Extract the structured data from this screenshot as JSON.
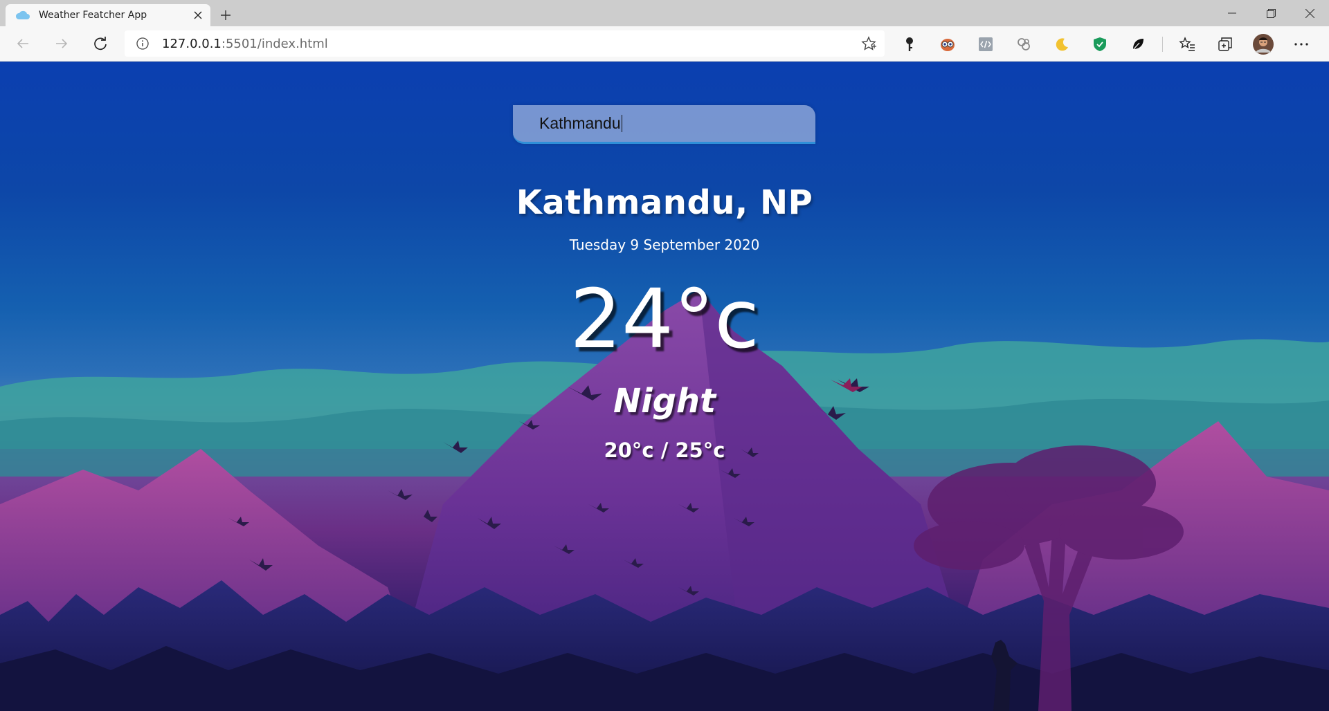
{
  "browser": {
    "tab_title": "Weather Featcher App",
    "url_host": "127.0.0.1",
    "url_path": ":5501/index.html",
    "icons": {
      "tab_favicon": "cloud-icon",
      "tab_close": "close-icon",
      "new_tab": "plus-icon",
      "back": "back-arrow-icon",
      "forward": "forward-arrow-icon",
      "reload": "reload-icon",
      "site_info": "info-icon",
      "favorite": "star-icon",
      "extensions": [
        "key-icon",
        "owl-icon",
        "code-icon",
        "link-icon",
        "moon-icon",
        "shield-icon",
        "leaf-icon"
      ],
      "favorites_list": "favorites-icon",
      "collections": "collections-icon",
      "profile": "avatar",
      "menu": "more-icon"
    }
  },
  "weather": {
    "search_value": "Kathmandu",
    "location": "Kathmandu, NP",
    "date": "Tuesday 9 September 2020",
    "temperature": "24°c",
    "condition": "Night",
    "hi_low": "20°c / 25°c"
  },
  "colors": {
    "sky_top": "#0b3fb0",
    "mountain": "#7a3a9e",
    "search_border": "#2f8fd8"
  }
}
